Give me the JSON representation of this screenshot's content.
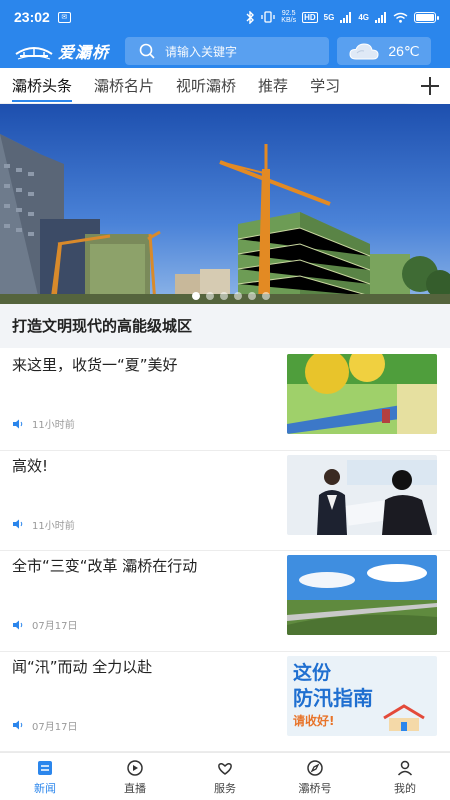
{
  "statusbar": {
    "time": "23:02",
    "network_speed_top": "92.5",
    "network_speed_bottom": "KB/s",
    "hd": "HD",
    "signal_5g": "5G",
    "signal_4g": "4G"
  },
  "header": {
    "logo_text": "爱灞桥",
    "search_placeholder": "请输入关键字",
    "weather_icon": "cloud-icon",
    "temperature": "26℃"
  },
  "tabs": {
    "items": [
      {
        "label": "灞桥头条",
        "active": true
      },
      {
        "label": "灞桥名片",
        "active": false
      },
      {
        "label": "视听灞桥",
        "active": false
      },
      {
        "label": "推荐",
        "active": false
      },
      {
        "label": "学习",
        "active": false
      }
    ],
    "add_icon": "plus-icon"
  },
  "banner": {
    "caption": "打造文明现代的高能级城区",
    "slide_count": 6,
    "active_slide": 0
  },
  "news": [
    {
      "title": "来这里，收货一“夏”美好",
      "time": "11小时前"
    },
    {
      "title": "高效!",
      "time": "11小时前"
    },
    {
      "title": "全市“三变“改革 灞桥在行动",
      "time": "07月17日"
    },
    {
      "title": "闻“汛”而动 全力以赴",
      "time": "07月17日",
      "thumb_text_1": "这份",
      "thumb_text_2": "防汛指南",
      "thumb_text_3": "请收好!"
    }
  ],
  "bottomnav": {
    "items": [
      {
        "label": "新闻",
        "icon": "news-icon",
        "active": true
      },
      {
        "label": "直播",
        "icon": "live-icon",
        "active": false
      },
      {
        "label": "服务",
        "icon": "service-icon",
        "active": false
      },
      {
        "label": "灞桥号",
        "icon": "compass-icon",
        "active": false
      },
      {
        "label": "我的",
        "icon": "user-icon",
        "active": false
      }
    ]
  },
  "colors": {
    "brand": "#2b86ec",
    "active_tab_underline": "#2b86ec"
  }
}
